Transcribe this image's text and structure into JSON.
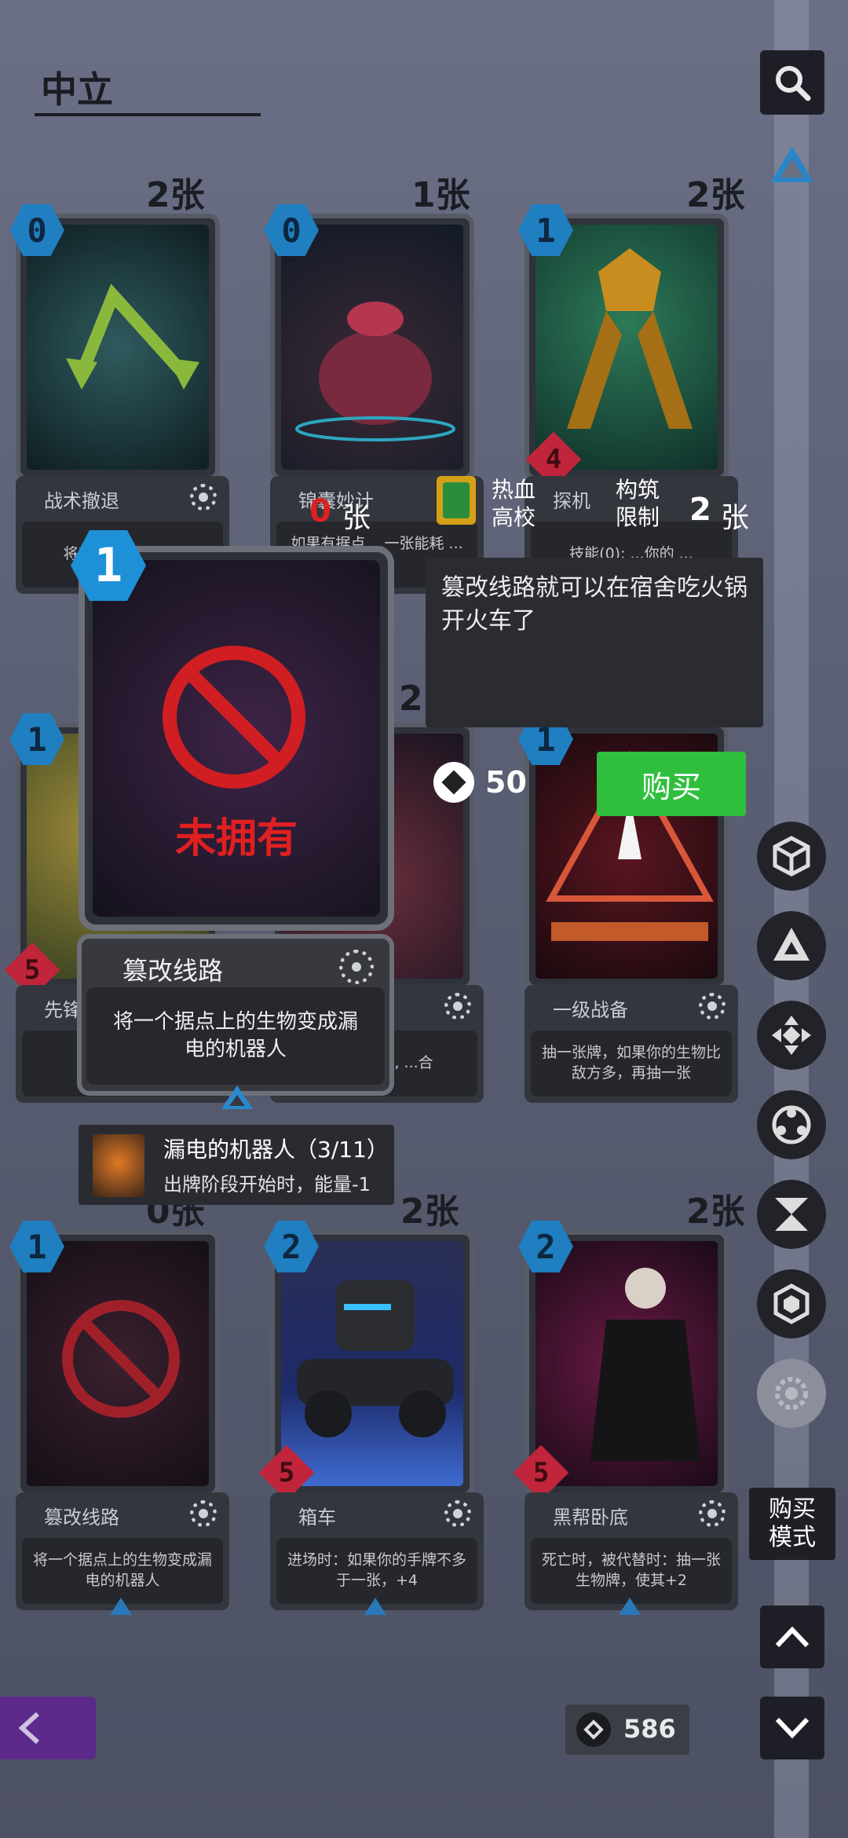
{
  "header": {
    "title": "中立"
  },
  "cards": [
    {
      "cost": "0",
      "count": "2张",
      "name": "战术撤退",
      "desc": "将所有...生物移回"
    },
    {
      "cost": "0",
      "count": "1张",
      "name": "锦囊妙计",
      "desc": "如果有据点 ...一张能耗 ...量的"
    },
    {
      "cost": "1",
      "count": "2张",
      "name": "探机",
      "desc": "技能(0): ...你的 ...",
      "attack": "4"
    },
    {
      "cost": "1",
      "name": "先锋",
      "desc": "",
      "attack": "5"
    },
    {
      "cost": "",
      "count": "2",
      "name": "",
      "desc": "...入手牌时, ...合"
    },
    {
      "cost": "1",
      "name": "一级战备",
      "desc": "抽一张牌，如果你的生物比敌方多，再抽一张"
    },
    {
      "cost": "1",
      "count": "0张",
      "name": "篡改线路",
      "desc": "将一个据点上的生物变成漏电的机器人"
    },
    {
      "cost": "2",
      "count": "2张",
      "name": "箱车",
      "desc": "进场时：如果你的手牌不多于一张，+4",
      "attack": "5"
    },
    {
      "cost": "2",
      "count": "2张",
      "name": "黑帮卧底",
      "desc": "死亡时，被代替时：抽一张生物牌，使其+2",
      "attack": "5"
    }
  ],
  "detail": {
    "cost": "1",
    "not_owned": "未拥有",
    "name": "篡改线路",
    "desc": "将一个据点上的生物变成漏电的机器人",
    "set_name": "热血高校",
    "owned_count": "0",
    "owned_unit": "张",
    "limit_label": "构筑限制",
    "limit_count": "2",
    "limit_unit": "张",
    "flavor": "篡改线路就可以在宿舍吃火锅开火车了",
    "price": "50",
    "buy_label": "购买",
    "token": {
      "name": "漏电的机器人（3/11）",
      "desc": "出牌阶段开始时，能量-1"
    }
  },
  "sidebar": {
    "buy_mode": "购买模式"
  },
  "footer": {
    "currency": "586"
  },
  "colors": {
    "cost_blue": "#1f7fc0",
    "attack_red": "#c0253b",
    "buy_green": "#2fbf3d",
    "not_owned_red": "#e02020",
    "back_purple": "#5b2a8a"
  }
}
